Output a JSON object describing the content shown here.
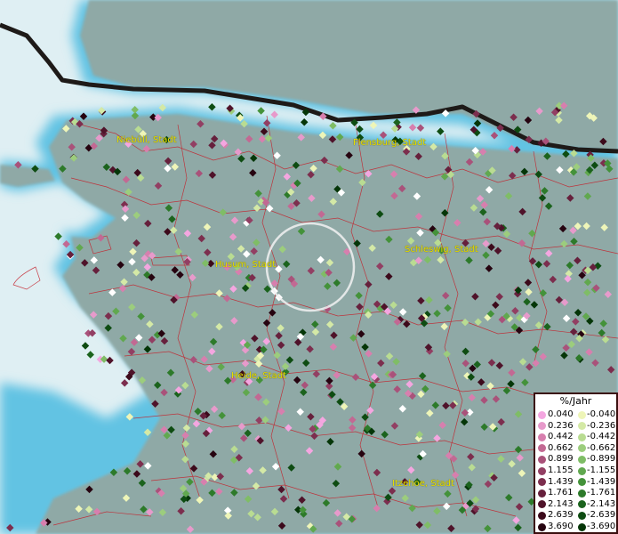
{
  "map": {
    "cities": [
      {
        "id": "niebuell",
        "label": "Niebüll, Stadt"
      },
      {
        "id": "flensburg",
        "label": "Flensburg, Stadt"
      },
      {
        "id": "schleswig",
        "label": "Schleswig, Stadt"
      },
      {
        "id": "husum",
        "label": "Husum, Stadt"
      },
      {
        "id": "heide",
        "label": "Heide, Stadt"
      },
      {
        "id": "itzehoe",
        "label": "Itzehoe, Stadt"
      }
    ],
    "colors": {
      "sea": "#dfeff3",
      "land": "#8ea9a5",
      "shore": "#5bbfe0",
      "border": "#1e1a18",
      "district_lines": "#c4212b"
    }
  },
  "legend": {
    "title": "%/Jahr",
    "positive": [
      {
        "label": "0.040",
        "color": "#f4a6e0"
      },
      {
        "label": "0.236",
        "color": "#e79acb"
      },
      {
        "label": "0.442",
        "color": "#d77fae"
      },
      {
        "label": "0.662",
        "color": "#c26993"
      },
      {
        "label": "0.899",
        "color": "#a9527a"
      },
      {
        "label": "1.155",
        "color": "#923f63"
      },
      {
        "label": "1.439",
        "color": "#7c2e4e"
      },
      {
        "label": "1.761",
        "color": "#66203c"
      },
      {
        "label": "2.143",
        "color": "#4f132a"
      },
      {
        "label": "2.639",
        "color": "#3c0a1b"
      },
      {
        "label": "3.690",
        "color": "#260410"
      }
    ],
    "negative": [
      {
        "label": "-0.040",
        "color": "#eef5b8"
      },
      {
        "label": "-0.236",
        "color": "#d4e9a6"
      },
      {
        "label": "-0.442",
        "color": "#b9dc92"
      },
      {
        "label": "-0.662",
        "color": "#9ccd7d"
      },
      {
        "label": "-0.899",
        "color": "#7fbd66"
      },
      {
        "label": "-1.155",
        "color": "#61a84f"
      },
      {
        "label": "-1.439",
        "color": "#44923a"
      },
      {
        "label": "-1.761",
        "color": "#2d7a2a"
      },
      {
        "label": "-2.143",
        "color": "#1b631d"
      },
      {
        "label": "-2.639",
        "color": "#0e4c12"
      },
      {
        "label": "-3.690",
        "color": "#053608"
      }
    ]
  }
}
